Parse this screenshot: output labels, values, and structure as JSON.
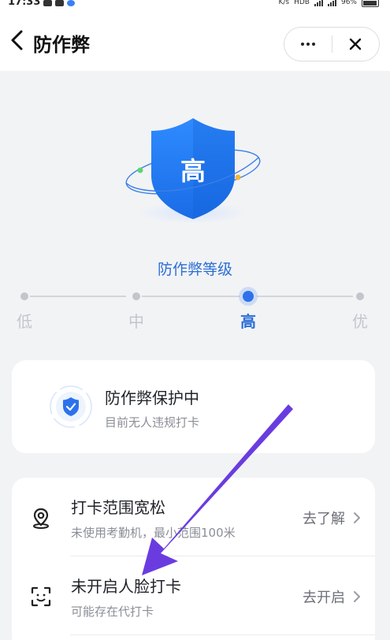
{
  "status_bar": {
    "time": "17:33",
    "network_speed": "K/s",
    "network_type": "HDB",
    "battery": "96%"
  },
  "nav": {
    "title": "防作弊",
    "back_icon": "chevron-left-icon",
    "more_icon": "more-icon",
    "close_icon": "close-icon"
  },
  "hero": {
    "shield_text": "高",
    "level_title": "防作弊等级"
  },
  "levels": {
    "options": [
      "低",
      "中",
      "高",
      "优"
    ],
    "selected": "高"
  },
  "protect_card": {
    "title": "防作弊保护中",
    "subtitle": "目前无人违规打卡"
  },
  "issues": [
    {
      "icon": "location-pin-icon",
      "title": "打卡范围宽松",
      "subtitle": "未使用考勤机，最小范围100米",
      "action": "去了解"
    },
    {
      "icon": "face-scan-icon",
      "title": "未开启人脸打卡",
      "subtitle": "可能存在代打卡",
      "action": "去开启"
    }
  ],
  "colors": {
    "accent": "#2d72ec",
    "background": "#f2f3f5",
    "annotation_arrow": "#6a3ce0"
  }
}
